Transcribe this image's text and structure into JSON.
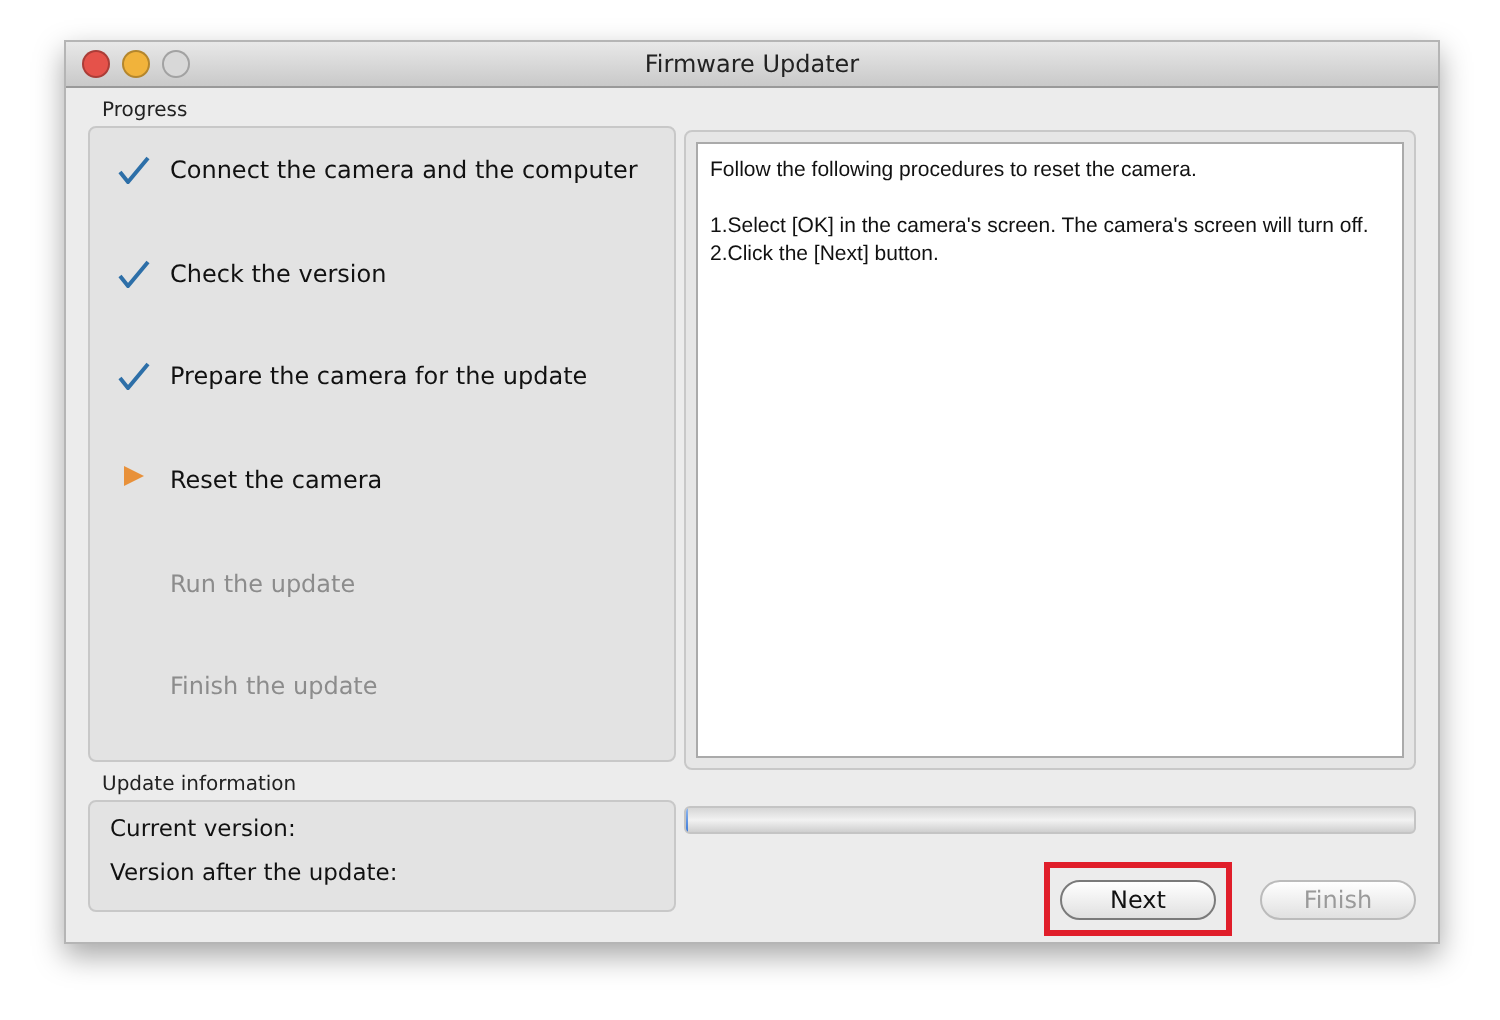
{
  "window": {
    "title": "Firmware Updater"
  },
  "progress": {
    "label": "Progress",
    "steps": [
      {
        "label": "Connect the camera and the computer",
        "kind": "done"
      },
      {
        "label": "Check the version",
        "kind": "done"
      },
      {
        "label": "Prepare the camera for the update",
        "kind": "done"
      },
      {
        "label": "Reset the camera",
        "kind": "current"
      },
      {
        "label": "Run the update",
        "kind": "pending"
      },
      {
        "label": "Finish the update",
        "kind": "pending"
      }
    ]
  },
  "instructions": {
    "intro": "Follow the following procedures to reset the camera.",
    "steps": [
      "1.Select [OK] in the camera's screen. The camera's screen will turn off.",
      "2.Click the [Next] button."
    ]
  },
  "update_information": {
    "label": "Update information",
    "fields": [
      {
        "label": "Current version:"
      },
      {
        "label": "Version after the update:"
      }
    ]
  },
  "update_progress": {
    "level": 0
  },
  "buttons": [
    {
      "label": "Next",
      "disabled": false,
      "highlighted": true
    },
    {
      "label": "Finish",
      "disabled": true,
      "highlighted": false
    }
  ]
}
